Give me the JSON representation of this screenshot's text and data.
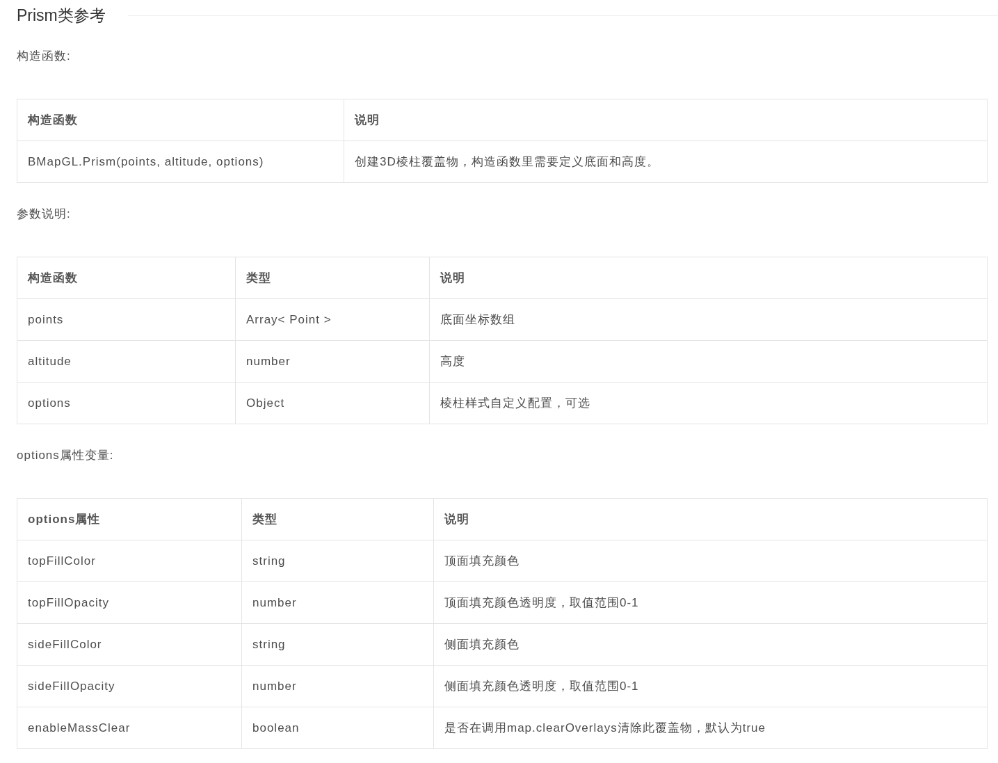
{
  "title": "Prism类参考",
  "sections": [
    {
      "label": "构造函数:",
      "table": {
        "columns": [
          "构造函数",
          "说明"
        ],
        "rows": [
          [
            "BMapGL.Prism(points, altitude, options)",
            "创建3D棱柱覆盖物，构造函数里需要定义底面和高度。"
          ]
        ]
      }
    },
    {
      "label": "参数说明:",
      "table": {
        "columns": [
          "构造函数",
          "类型",
          "说明"
        ],
        "rows": [
          [
            "points",
            "Array< Point >",
            "底面坐标数组"
          ],
          [
            "altitude",
            "number",
            "高度"
          ],
          [
            "options",
            "Object",
            "棱柱样式自定义配置，可选"
          ]
        ]
      }
    },
    {
      "label": "options属性变量:",
      "table": {
        "columns": [
          "options属性",
          "类型",
          "说明"
        ],
        "rows": [
          [
            "topFillColor",
            "string",
            "顶面填充颜色"
          ],
          [
            "topFillOpacity",
            "number",
            "顶面填充颜色透明度，取值范围0-1"
          ],
          [
            "sideFillColor",
            "string",
            "侧面填充颜色"
          ],
          [
            "sideFillOpacity",
            "number",
            "侧面填充颜色透明度，取值范围0-1"
          ],
          [
            "enableMassClear",
            "boolean",
            "是否在调用map.clearOverlays清除此覆盖物，默认为true"
          ]
        ]
      }
    }
  ]
}
